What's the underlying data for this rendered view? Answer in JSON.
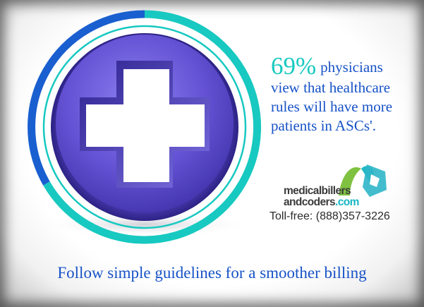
{
  "stat": {
    "percent": "69%",
    "lines": [
      "physicians",
      "view that healthcare",
      "rules will have more",
      "patients in ASCs'."
    ]
  },
  "logo": {
    "line1": "medicalbillers",
    "line2_main": "andcoders",
    "line2_suffix": ".com"
  },
  "contact": {
    "phone": "Toll-free: (888)357-3226"
  },
  "tagline": "Follow simple guidelines for a smoother billing",
  "icons": {
    "badge": "medical-cross-icon",
    "logo": "logo-mark-icon"
  },
  "colors": {
    "heading_blue": "#1652c7",
    "accent_teal": "#17c9c0",
    "badge_purple": "#6a5ad6",
    "ring_blue": "#1a5fd0"
  }
}
